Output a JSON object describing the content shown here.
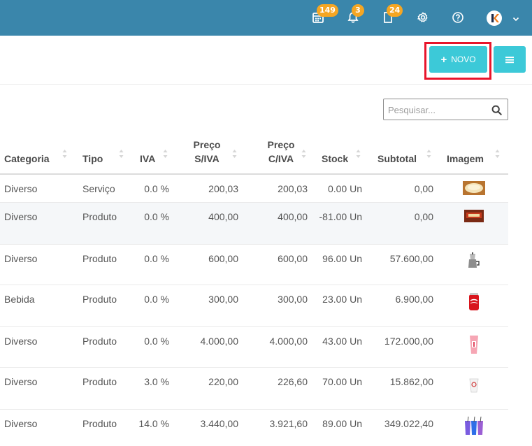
{
  "topbar": {
    "calendar_badge": "149",
    "bell_badge": "3",
    "document_badge": "24",
    "avatar_letter": "K",
    "bg_color": "#3a86ab",
    "badge_color": "#f5a623"
  },
  "toolbar": {
    "new_label": "NOVO",
    "accent_color": "#3cc9d8",
    "highlight_color": "#e8152b"
  },
  "search": {
    "placeholder": "Pesquisar..."
  },
  "table": {
    "headers": {
      "categoria": "Categoria",
      "tipo": "Tipo",
      "iva": "IVA",
      "preco_siva_1": "Preço",
      "preco_siva_2": "S/IVA",
      "preco_civa_1": "Preço",
      "preco_civa_2": "C/IVA",
      "stock": "Stock",
      "subtotal": "Subtotal",
      "imagem": "Imagem"
    },
    "rows": [
      {
        "categoria": "Diverso",
        "tipo": "Serviço",
        "iva": "0.0 %",
        "preco_siva": "200,03",
        "preco_civa": "200,03",
        "stock": "0.00 Un",
        "subtotal": "0,00",
        "image": "cake-image"
      },
      {
        "categoria": "Diverso",
        "tipo": "Produto",
        "iva": "0.0 %",
        "preco_siva": "400,00",
        "preco_civa": "400,00",
        "stock": "-81.00 Un",
        "subtotal": "0,00",
        "image": "chocolate-box-image"
      },
      {
        "categoria": "Diverso",
        "tipo": "Produto",
        "iva": "0.0 %",
        "preco_siva": "600,00",
        "preco_civa": "600,00",
        "stock": "96.00 Un",
        "subtotal": "57.600,00",
        "image": "coffee-maker-image"
      },
      {
        "categoria": "Bebida",
        "tipo": "Produto",
        "iva": "0.0 %",
        "preco_siva": "300,00",
        "preco_civa": "300,00",
        "stock": "23.00 Un",
        "subtotal": "6.900,00",
        "image": "cola-can-image"
      },
      {
        "categoria": "Diverso",
        "tipo": "Produto",
        "iva": "0.0 %",
        "preco_siva": "4.000,00",
        "preco_civa": "4.000,00",
        "stock": "43.00 Un",
        "subtotal": "172.000,00",
        "image": "pink-cup-image"
      },
      {
        "categoria": "Diverso",
        "tipo": "Produto",
        "iva": "3.0 %",
        "preco_siva": "220,00",
        "preco_civa": "226,60",
        "stock": "70.00 Un",
        "subtotal": "15.862,00",
        "image": "paper-cup-image"
      },
      {
        "categoria": "Diverso",
        "tipo": "Produto",
        "iva": "14.0 %",
        "preco_siva": "3.440,00",
        "preco_civa": "3.921,60",
        "stock": "89.00 Un",
        "subtotal": "349.022,40",
        "image": "tumblers-image"
      }
    ]
  }
}
